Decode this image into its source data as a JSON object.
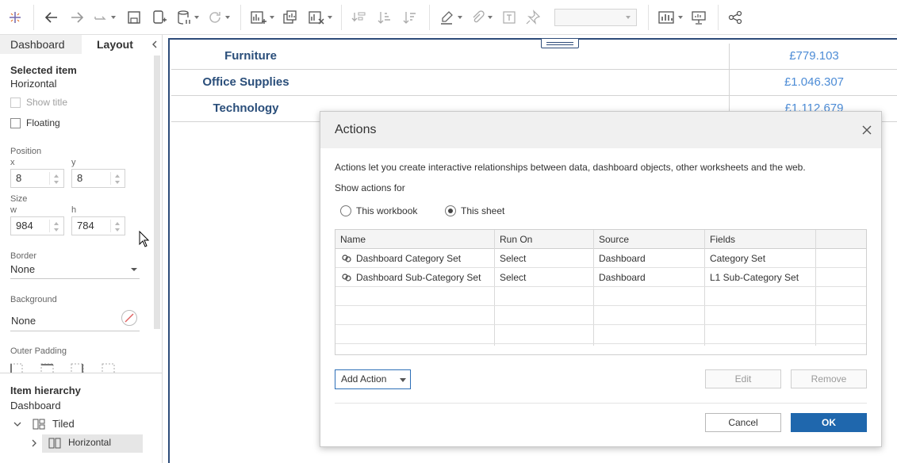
{
  "toolbar": {
    "icons": [
      "tableau-logo-icon",
      "undo-icon",
      "redo-icon",
      "replay-icon",
      "save-icon",
      "new-datasource-icon",
      "pause-updates-icon",
      "refresh-icon",
      "new-worksheet-icon",
      "duplicate-sheet-icon",
      "clear-sheet-icon",
      "swap-icon",
      "sort-ascending-icon",
      "sort-descending-icon",
      "highlight-icon",
      "annotate-icon",
      "label-icon",
      "pin-icon",
      "show-me-icon",
      "presentation-icon",
      "share-icon"
    ],
    "fit_dropdown_value": ""
  },
  "left_panel": {
    "tabs": [
      "Dashboard",
      "Layout"
    ],
    "active_tab": "Layout",
    "selected_item_title": "Selected item",
    "selected_item_value": "Horizontal",
    "show_title_label": "Show title",
    "floating_label": "Floating",
    "position_label": "Position",
    "x_label": "x",
    "y_label": "y",
    "x_value": "8",
    "y_value": "8",
    "size_label": "Size",
    "w_label": "w",
    "h_label": "h",
    "w_value": "984",
    "h_value": "784",
    "border_label": "Border",
    "border_value": "None",
    "background_label": "Background",
    "background_value": "None",
    "outer_padding_label": "Outer Padding",
    "item_hierarchy_title": "Item hierarchy",
    "hierarchy_root": "Dashboard",
    "hierarchy_tiled": "Tiled",
    "hierarchy_horizontal": "Horizontal"
  },
  "canvas": {
    "rows": [
      {
        "category": "Furniture",
        "value": "£779.103"
      },
      {
        "category": "Office Supplies",
        "value": "£1.046.307"
      },
      {
        "category": "Technology",
        "value": "£1.112.679"
      }
    ]
  },
  "dialog": {
    "title": "Actions",
    "description": "Actions let you create interactive relationships between data, dashboard objects, other worksheets and the web.",
    "show_actions_for": "Show actions for",
    "radio_workbook": "This workbook",
    "radio_sheet": "This sheet",
    "selected_radio": "This sheet",
    "columns": [
      "Name",
      "Run On",
      "Source",
      "Fields"
    ],
    "rows": [
      {
        "name": "Dashboard Category Set",
        "run_on": "Select",
        "source": "Dashboard",
        "fields": "Category Set"
      },
      {
        "name": "Dashboard Sub-Category Set",
        "run_on": "Select",
        "source": "Dashboard",
        "fields": "L1 Sub-Category Set"
      }
    ],
    "add_action_label": "Add Action",
    "edit_label": "Edit",
    "remove_label": "Remove",
    "cancel_label": "Cancel",
    "ok_label": "OK"
  },
  "colors": {
    "accent": "#1f67ad",
    "category_text": "#2a4e7a",
    "value_text": "#4d8cd6"
  }
}
